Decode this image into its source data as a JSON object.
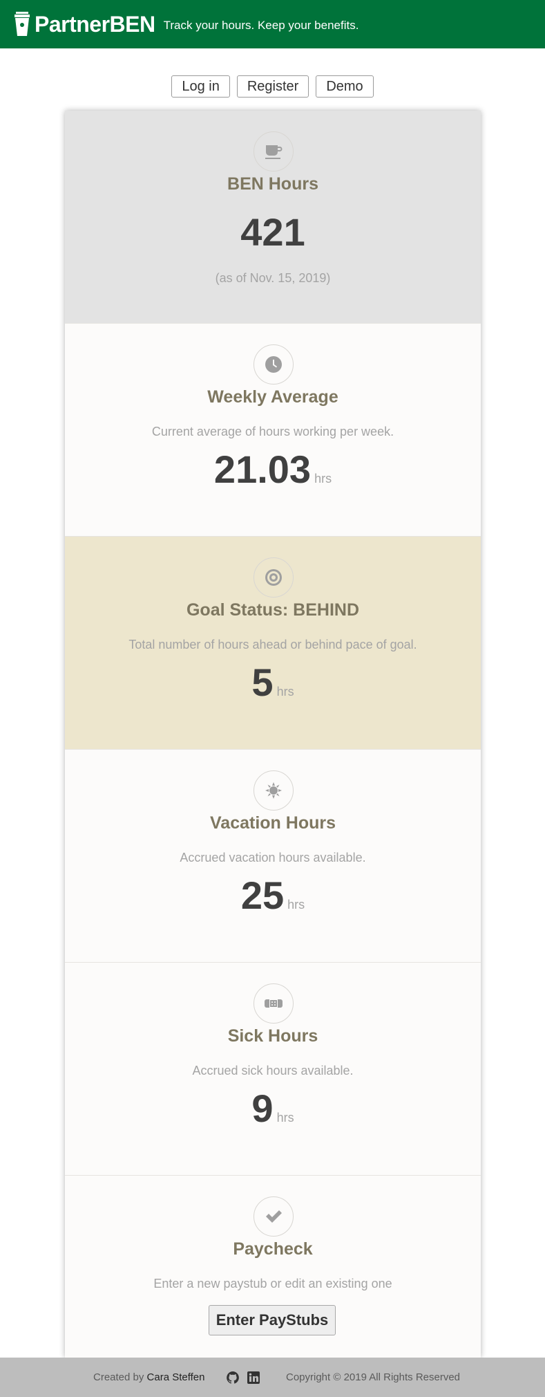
{
  "header": {
    "brand": "PartnerBEN",
    "tagline": "Track your hours. Keep your benefits.",
    "background_color": "#00733a"
  },
  "auth": {
    "login_label": "Log in",
    "register_label": "Register",
    "demo_label": "Demo"
  },
  "cards": {
    "ben": {
      "title": "BEN Hours",
      "value": "421",
      "date": "(as of Nov. 15, 2019)",
      "icon": "coffee-cup-icon"
    },
    "weekly": {
      "title": "Weekly Average",
      "desc": "Current average of hours working per week.",
      "value": "21.03",
      "unit": "hrs",
      "icon": "clock-icon"
    },
    "goal": {
      "title": "Goal Status: BEHIND",
      "desc": "Total number of hours ahead or behind pace of goal.",
      "value": "5",
      "unit": "hrs",
      "icon": "target-icon"
    },
    "vacation": {
      "title": "Vacation Hours",
      "desc": "Accrued vacation hours available.",
      "value": "25",
      "unit": "hrs",
      "icon": "sun-icon"
    },
    "sick": {
      "title": "Sick Hours",
      "desc": "Accrued sick hours available.",
      "value": "9",
      "unit": "hrs",
      "icon": "bandage-icon"
    },
    "paycheck": {
      "title": "Paycheck",
      "desc": "Enter a new paystub or edit an existing one",
      "button_label": "Enter PayStubs",
      "icon": "checkmark-icon"
    }
  },
  "footer": {
    "created_prefix": "Created by",
    "author": "Cara Steffen",
    "copyright": "Copyright © 2019 All Rights Reserved",
    "social_icons": [
      "github-icon",
      "linkedin-icon"
    ]
  },
  "colors": {
    "accent_green": "#00733a",
    "title_olive": "#7e7760",
    "goal_bg": "#ede6cd",
    "ben_bg": "#e3e3e3"
  }
}
